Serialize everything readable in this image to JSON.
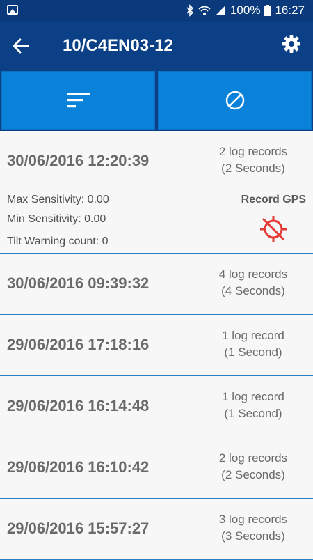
{
  "status_bar": {
    "battery": "100%",
    "time": "16:27"
  },
  "app_bar": {
    "title": "10/C4EN03-12"
  },
  "toolbar": {
    "sort_icon": "sort-icon",
    "block_icon": "block-icon"
  },
  "records": [
    {
      "date": "30/06/2016 12:20:39",
      "log_count": "2 log records",
      "duration": "(2 Seconds)",
      "max_sensitivity": "Max Sensitivity: 0.00",
      "min_sensitivity": "Min Sensitivity: 0.00",
      "tilt_warning": "Tilt Warning count: 0",
      "gps_label": "Record GPS",
      "gps_icon": "gps-off-icon",
      "gps_color": "#e53935"
    },
    {
      "date": "30/06/2016 09:39:32",
      "log_count": "4 log records",
      "duration": "(4 Seconds)"
    },
    {
      "date": "29/06/2016 17:18:16",
      "log_count": "1 log record",
      "duration": "(1 Second)"
    },
    {
      "date": "29/06/2016 16:14:48",
      "log_count": "1 log record",
      "duration": "(1 Second)"
    },
    {
      "date": "29/06/2016 16:10:42",
      "log_count": "2 log records",
      "duration": "(2 Seconds)"
    },
    {
      "date": "29/06/2016 15:57:27",
      "log_count": "3 log records",
      "duration": "(3 Seconds)"
    }
  ],
  "colors": {
    "app_bar": "#0b3f86",
    "toolbar_button": "#0a82d9",
    "divider": "#2a7fc2"
  }
}
